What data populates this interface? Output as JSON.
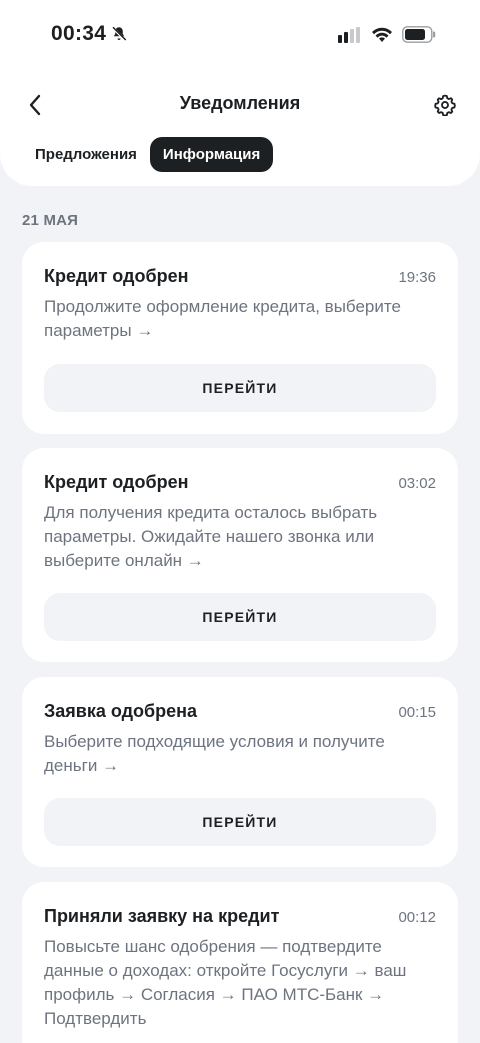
{
  "status_bar": {
    "time": "00:34",
    "icons": [
      "bell-slash-icon",
      "signal-icon",
      "wifi-icon",
      "battery-icon"
    ]
  },
  "header": {
    "title": "Уведомления",
    "back_icon": "chevron-left-icon",
    "settings_icon": "gear-icon"
  },
  "tabs": [
    {
      "label": "Предложения",
      "active": false
    },
    {
      "label": "Информация",
      "active": true
    }
  ],
  "date_label": "21 МАЯ",
  "notifications": [
    {
      "title": "Кредит одобрен",
      "time": "19:36",
      "text": "Продолжите оформление кредита, выберите параметры →",
      "button": "ПЕРЕЙТИ"
    },
    {
      "title": "Кредит одобрен",
      "time": "03:02",
      "text": "Для получения кредита осталось выбрать параметры. Ожидайте нашего звонка или выберите онлайн →",
      "button": "ПЕРЕЙТИ"
    },
    {
      "title": "Заявка одобрена",
      "time": "00:15",
      "text": "Выберите подходящие условия и получите деньги →",
      "button": "ПЕРЕЙТИ"
    },
    {
      "title": "Приняли заявку на кредит",
      "time": "00:12",
      "text": "Повысьте шанс одобрения — подтвердите данные о доходах: откройте Госуслуги → ваш профиль → Согласия → ПАО МТС-Банк → Подтвердить"
    }
  ],
  "colors": {
    "accent": "#1d2023",
    "secondary_text": "#6d7480",
    "background": "#f2f3f7",
    "card": "#ffffff"
  }
}
